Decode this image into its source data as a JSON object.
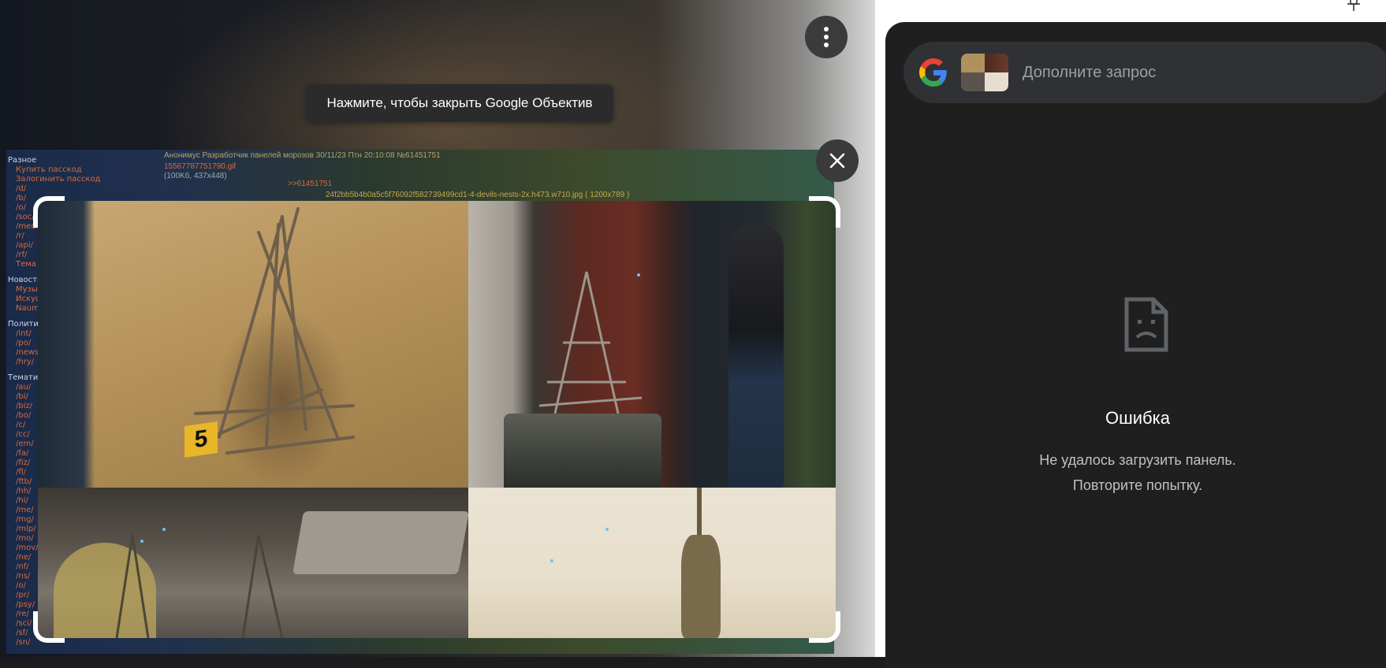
{
  "tooltip": {
    "text": "Нажмите, чтобы закрыть Google Объектив"
  },
  "snippet": {
    "nav_items": [
      "Разное",
      "Купить пасскод",
      "Залогинить пасскод",
      "/d/",
      "/b/",
      "/o/",
      "/soc/",
      "/media/",
      "/r/",
      "/api/",
      "/rf/",
      "Тема",
      "Новости",
      "Музыка",
      "Искусство",
      "Naum",
      "Политика",
      "/int/",
      "/po/",
      "/news/",
      "/hry/",
      "Тематика",
      "/au/",
      "/bi/",
      "/biz/",
      "/bo/",
      "/c/",
      "/cc/",
      "/em/",
      "/fa/",
      "/fiz/",
      "/fl/",
      "/ftb/",
      "/hh/",
      "/hi/",
      "/me/",
      "/mg/",
      "/mlp/",
      "/mo/",
      "/mov/",
      "/ne/",
      "/nf/",
      "/ns/",
      "/o/",
      "/pr/",
      "/psy/",
      "/re/",
      "/sci/",
      "/sf/",
      "/sn/"
    ],
    "post_header": "Анонимус Разработчик панелей морозов  30/11/23 Птн 20:10:08 №61451751",
    "file_name": "15567787751790.gif",
    "file_meta": "(100Kб, 437x448)",
    "reply_link": ">>61451751",
    "image_link": "24f2bb5b4b0a5c5f76092f582739499cd1-4-devils-nests-2x.h473.w710.jpg ( 1200x789 )"
  },
  "evidence_marker": "5",
  "side_panel": {
    "search_placeholder": "Дополните запрос",
    "error_title": "Ошибка",
    "error_line1": "Не удалось загрузить панель.",
    "error_line2": "Повторите попытку."
  },
  "colors": {
    "panel_bg": "#1f1f1f",
    "search_bg": "#303134",
    "google_blue": "#4285F4",
    "google_red": "#EA4335",
    "google_yellow": "#FBBC05",
    "google_green": "#34A853"
  },
  "icons": [
    "more-vert-icon",
    "close-icon",
    "google-g-icon",
    "broken-page-icon",
    "pin-icon"
  ]
}
